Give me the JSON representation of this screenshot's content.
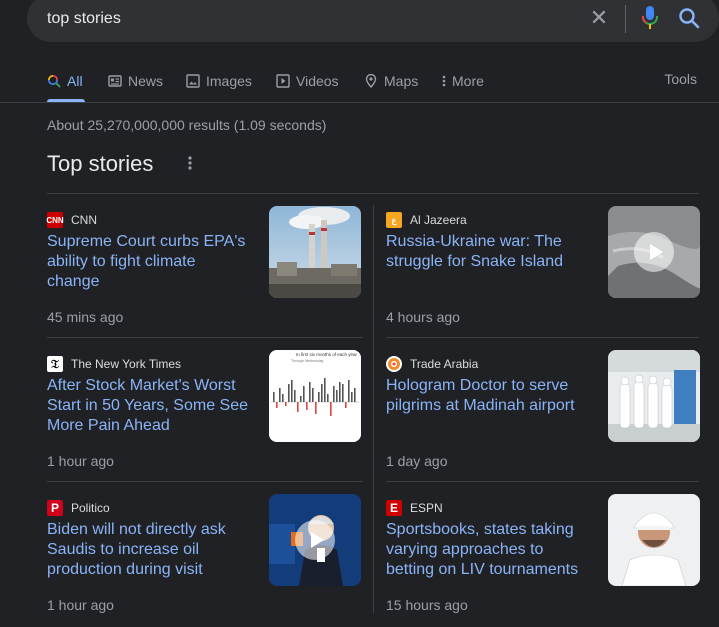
{
  "search": {
    "query": "top stories"
  },
  "tabs": [
    {
      "label": "All",
      "icon": "search-icon",
      "active": true
    },
    {
      "label": "News",
      "icon": "news-icon"
    },
    {
      "label": "Images",
      "icon": "image-icon"
    },
    {
      "label": "Videos",
      "icon": "video-icon"
    },
    {
      "label": "Maps",
      "icon": "map-pin-icon"
    },
    {
      "label": "More",
      "icon": "more-vert-icon"
    }
  ],
  "tools_label": "Tools",
  "result_stats": "About 25,270,000,000 results (1.09 seconds)",
  "section_title": "Top stories",
  "stories": [
    {
      "source": "CNN",
      "headline": "Supreme Court curbs EPA's ability to fight climate change",
      "time": "45 mins ago",
      "thumbnail": "power-plant-smokestacks-image",
      "video": false
    },
    {
      "source": "Al Jazeera",
      "headline": "Russia-Ukraine war: The struggle for Snake Island",
      "time": "4 hours ago",
      "thumbnail": "aerial-island-video-thumbnail",
      "video": true
    },
    {
      "source": "The New York Times",
      "headline": "After Stock Market's Worst Start in 50 Years, Some See More Pain Ahead",
      "time": "1 hour ago",
      "thumbnail": "stock-bar-chart-image",
      "video": false,
      "thumbnail_caption": "In first six months of each year",
      "thumbnail_subcaption": "Through Wednesday"
    },
    {
      "source": "Trade Arabia",
      "headline": "Hologram Doctor to serve pilgrims at Madinah airport",
      "time": "1 day ago",
      "thumbnail": "people-in-white-robes-image",
      "video": false
    },
    {
      "source": "Politico",
      "headline": "Biden will not directly ask Saudis to increase oil production during visit",
      "time": "1 hour ago",
      "thumbnail": "biden-speaking-video-thumbnail",
      "video": true
    },
    {
      "source": "ESPN",
      "headline": "Sportsbooks, states taking varying approaches to betting on LIV tournaments",
      "time": "15 hours ago",
      "thumbnail": "golfer-portrait-image",
      "video": false
    }
  ],
  "colors": {
    "background": "#202124",
    "link": "#8ab4f8",
    "accent_blue": "#8ab4f8",
    "cnn_red": "#cc0000",
    "aljazeera_orange": "#f5a623",
    "espn_red": "#d00000",
    "politico_red": "#d0021b"
  }
}
